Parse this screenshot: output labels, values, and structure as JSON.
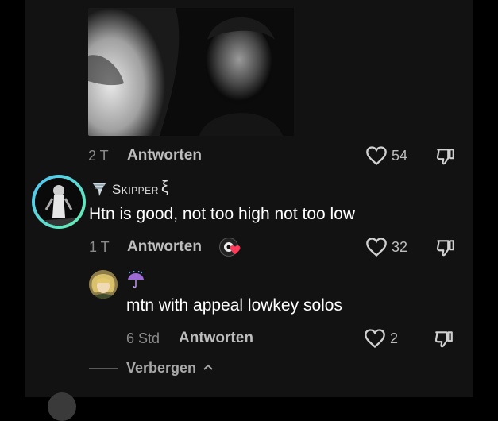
{
  "top_comment": {
    "time": "2 T",
    "reply_label": "Antworten",
    "like_count": "54"
  },
  "comment": {
    "username": "Skipper",
    "username_suffix": "ξ",
    "text": "Htn is good, not too high not too low",
    "time": "1 T",
    "reply_label": "Antworten",
    "like_count": "32"
  },
  "reply": {
    "username_icon": "umbrella-rain-icon",
    "text": "mtn with appeal lowkey solos",
    "time": "6 Std",
    "reply_label": "Antworten",
    "like_count": "2"
  },
  "footer": {
    "hide_label": "Verbergen"
  },
  "colors": {
    "background": "#000000",
    "panel": "#121212",
    "avatar_ring_start": "#4fc3f7",
    "avatar_ring_end": "#69f0ae",
    "heart_badge": "#ff3b5c",
    "muted_text": "#8a8a8a"
  }
}
